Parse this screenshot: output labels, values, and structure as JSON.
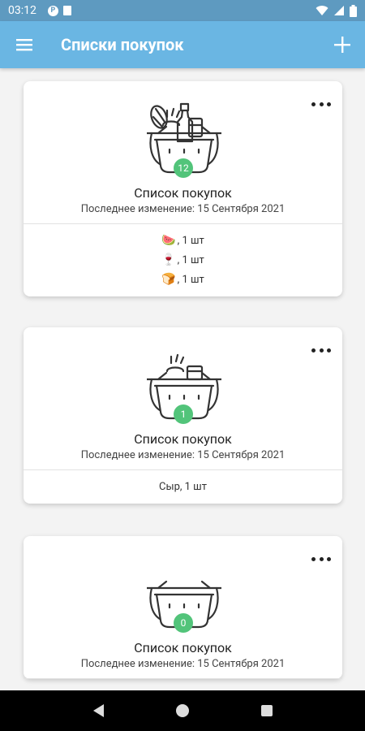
{
  "status_bar": {
    "time": "03:12",
    "app_icon_letter": "P"
  },
  "app_bar": {
    "title": "Списки покупок"
  },
  "lists": [
    {
      "title": "Список покупок",
      "subtitle": "Последнее изменение: 15 Сентября 2021",
      "count": "12",
      "basket_contents": "full",
      "items": [
        {
          "emoji": "🍉",
          "text": ", 1 шт"
        },
        {
          "emoji": "🍷",
          "text": ", 1 шт"
        },
        {
          "emoji": "🍞",
          "text": ", 1 шт"
        }
      ]
    },
    {
      "title": "Список покупок",
      "subtitle": "Последнее изменение: 15 Сентября 2021",
      "count": "1",
      "basket_contents": "partial",
      "items": [
        {
          "emoji": "",
          "text": "Сыр, 1 шт"
        }
      ]
    },
    {
      "title": "Список покупок",
      "subtitle": "Последнее изменение: 15 Сентября 2021",
      "count": "0",
      "basket_contents": "empty",
      "items": []
    }
  ],
  "icons": {
    "menu": "menu-icon",
    "add": "plus-icon",
    "more": "more-horizontal-icon",
    "basket": "shopping-basket-icon",
    "nav_back": "back-triangle-icon",
    "nav_home": "home-circle-icon",
    "nav_recent": "recent-square-icon"
  },
  "colors": {
    "status_bar": "#5e9ac0",
    "app_bar": "#6ab6e3",
    "badge": "#52c47a"
  }
}
